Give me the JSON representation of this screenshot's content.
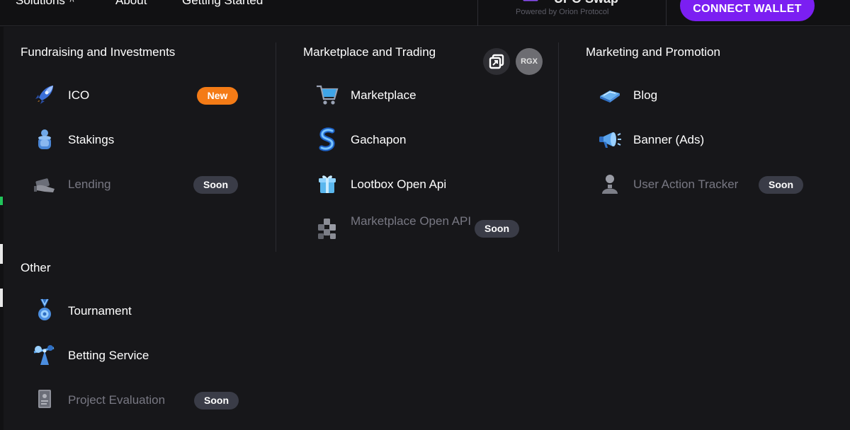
{
  "nav": {
    "solutions_label": "Solutions",
    "about_label": "About",
    "getting_started_label": "Getting Started",
    "swap_title": "UPO Swap",
    "swap_subtitle": "Powered by Orion Protocol",
    "connect_wallet_label": "CONNECT WALLET"
  },
  "colors": {
    "accent_purple": "#7b1ff2",
    "badge_new": "#f47b16",
    "badge_soon": "#3a3c47",
    "panel_bg": "#17171a"
  },
  "sections": {
    "fundraising": {
      "title": "Fundraising and Investments",
      "items": [
        {
          "label": "ICO",
          "icon": "rocket-icon",
          "badge": "New",
          "disabled": false
        },
        {
          "label": "Stakings",
          "icon": "coin-stack-icon",
          "badge": "",
          "disabled": false
        },
        {
          "label": "Lending",
          "icon": "hand-money-icon",
          "badge": "Soon",
          "disabled": true
        }
      ]
    },
    "marketplace": {
      "title": "Marketplace and Trading",
      "copy_icon": "copy-icon",
      "rgx_label": "RGX",
      "items": [
        {
          "label": "Marketplace",
          "icon": "shopping-cart-icon",
          "badge": "",
          "disabled": false
        },
        {
          "label": "Gachapon",
          "icon": "gachapon-icon",
          "badge": "",
          "disabled": false
        },
        {
          "label": "Lootbox Open Api",
          "icon": "gift-box-icon",
          "badge": "",
          "disabled": false
        },
        {
          "label": "Marketplace Open API",
          "icon": "cubes-icon",
          "badge": "Soon",
          "disabled": true
        }
      ]
    },
    "marketing": {
      "title": "Marketing and Promotion",
      "items": [
        {
          "label": "Blog",
          "icon": "book-icon",
          "badge": "",
          "disabled": false
        },
        {
          "label": "Banner (Ads)",
          "icon": "megaphone-icon",
          "badge": "",
          "disabled": false
        },
        {
          "label": "User Action Tracker",
          "icon": "user-icon",
          "badge": "Soon",
          "disabled": true
        }
      ]
    },
    "other": {
      "title": "Other",
      "items": [
        {
          "label": "Tournament",
          "icon": "medal-icon",
          "badge": "",
          "disabled": false
        },
        {
          "label": "Betting Service",
          "icon": "scale-icon",
          "badge": "",
          "disabled": false
        },
        {
          "label": "Project Evaluation",
          "icon": "document-icon",
          "badge": "Soon",
          "disabled": true
        }
      ]
    }
  }
}
